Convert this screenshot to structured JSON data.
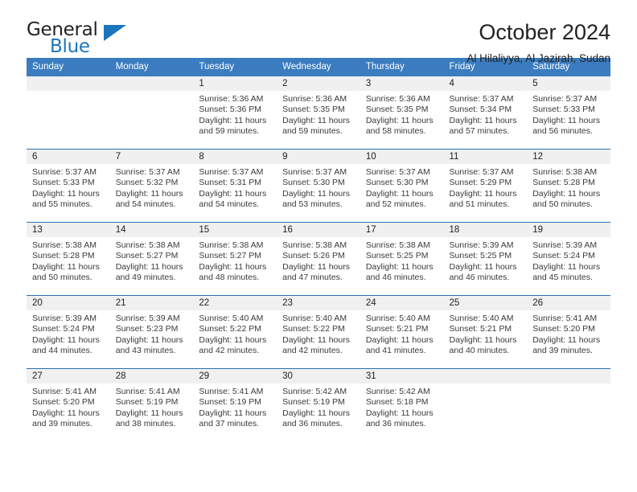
{
  "brand": {
    "name_top": "General",
    "name_bottom": "Blue",
    "accent_color": "#1b75bb"
  },
  "header": {
    "title": "October 2024",
    "subtitle": "Al Hilaliyya, Al Jazirah, Sudan"
  },
  "colors": {
    "header_row_bg": "#3a7cbf",
    "header_row_text": "#ffffff",
    "day_band_bg": "#f0f0f0",
    "week_divider": "#2f6fb2"
  },
  "weekday_headers": [
    "Sunday",
    "Monday",
    "Tuesday",
    "Wednesday",
    "Thursday",
    "Friday",
    "Saturday"
  ],
  "weeks": [
    [
      {
        "day": "",
        "sunrise": "",
        "sunset": "",
        "daylight_1": "",
        "daylight_2": ""
      },
      {
        "day": "",
        "sunrise": "",
        "sunset": "",
        "daylight_1": "",
        "daylight_2": ""
      },
      {
        "day": "1",
        "sunrise": "Sunrise: 5:36 AM",
        "sunset": "Sunset: 5:36 PM",
        "daylight_1": "Daylight: 11 hours",
        "daylight_2": "and 59 minutes."
      },
      {
        "day": "2",
        "sunrise": "Sunrise: 5:36 AM",
        "sunset": "Sunset: 5:35 PM",
        "daylight_1": "Daylight: 11 hours",
        "daylight_2": "and 59 minutes."
      },
      {
        "day": "3",
        "sunrise": "Sunrise: 5:36 AM",
        "sunset": "Sunset: 5:35 PM",
        "daylight_1": "Daylight: 11 hours",
        "daylight_2": "and 58 minutes."
      },
      {
        "day": "4",
        "sunrise": "Sunrise: 5:37 AM",
        "sunset": "Sunset: 5:34 PM",
        "daylight_1": "Daylight: 11 hours",
        "daylight_2": "and 57 minutes."
      },
      {
        "day": "5",
        "sunrise": "Sunrise: 5:37 AM",
        "sunset": "Sunset: 5:33 PM",
        "daylight_1": "Daylight: 11 hours",
        "daylight_2": "and 56 minutes."
      }
    ],
    [
      {
        "day": "6",
        "sunrise": "Sunrise: 5:37 AM",
        "sunset": "Sunset: 5:33 PM",
        "daylight_1": "Daylight: 11 hours",
        "daylight_2": "and 55 minutes."
      },
      {
        "day": "7",
        "sunrise": "Sunrise: 5:37 AM",
        "sunset": "Sunset: 5:32 PM",
        "daylight_1": "Daylight: 11 hours",
        "daylight_2": "and 54 minutes."
      },
      {
        "day": "8",
        "sunrise": "Sunrise: 5:37 AM",
        "sunset": "Sunset: 5:31 PM",
        "daylight_1": "Daylight: 11 hours",
        "daylight_2": "and 54 minutes."
      },
      {
        "day": "9",
        "sunrise": "Sunrise: 5:37 AM",
        "sunset": "Sunset: 5:30 PM",
        "daylight_1": "Daylight: 11 hours",
        "daylight_2": "and 53 minutes."
      },
      {
        "day": "10",
        "sunrise": "Sunrise: 5:37 AM",
        "sunset": "Sunset: 5:30 PM",
        "daylight_1": "Daylight: 11 hours",
        "daylight_2": "and 52 minutes."
      },
      {
        "day": "11",
        "sunrise": "Sunrise: 5:37 AM",
        "sunset": "Sunset: 5:29 PM",
        "daylight_1": "Daylight: 11 hours",
        "daylight_2": "and 51 minutes."
      },
      {
        "day": "12",
        "sunrise": "Sunrise: 5:38 AM",
        "sunset": "Sunset: 5:28 PM",
        "daylight_1": "Daylight: 11 hours",
        "daylight_2": "and 50 minutes."
      }
    ],
    [
      {
        "day": "13",
        "sunrise": "Sunrise: 5:38 AM",
        "sunset": "Sunset: 5:28 PM",
        "daylight_1": "Daylight: 11 hours",
        "daylight_2": "and 50 minutes."
      },
      {
        "day": "14",
        "sunrise": "Sunrise: 5:38 AM",
        "sunset": "Sunset: 5:27 PM",
        "daylight_1": "Daylight: 11 hours",
        "daylight_2": "and 49 minutes."
      },
      {
        "day": "15",
        "sunrise": "Sunrise: 5:38 AM",
        "sunset": "Sunset: 5:27 PM",
        "daylight_1": "Daylight: 11 hours",
        "daylight_2": "and 48 minutes."
      },
      {
        "day": "16",
        "sunrise": "Sunrise: 5:38 AM",
        "sunset": "Sunset: 5:26 PM",
        "daylight_1": "Daylight: 11 hours",
        "daylight_2": "and 47 minutes."
      },
      {
        "day": "17",
        "sunrise": "Sunrise: 5:38 AM",
        "sunset": "Sunset: 5:25 PM",
        "daylight_1": "Daylight: 11 hours",
        "daylight_2": "and 46 minutes."
      },
      {
        "day": "18",
        "sunrise": "Sunrise: 5:39 AM",
        "sunset": "Sunset: 5:25 PM",
        "daylight_1": "Daylight: 11 hours",
        "daylight_2": "and 46 minutes."
      },
      {
        "day": "19",
        "sunrise": "Sunrise: 5:39 AM",
        "sunset": "Sunset: 5:24 PM",
        "daylight_1": "Daylight: 11 hours",
        "daylight_2": "and 45 minutes."
      }
    ],
    [
      {
        "day": "20",
        "sunrise": "Sunrise: 5:39 AM",
        "sunset": "Sunset: 5:24 PM",
        "daylight_1": "Daylight: 11 hours",
        "daylight_2": "and 44 minutes."
      },
      {
        "day": "21",
        "sunrise": "Sunrise: 5:39 AM",
        "sunset": "Sunset: 5:23 PM",
        "daylight_1": "Daylight: 11 hours",
        "daylight_2": "and 43 minutes."
      },
      {
        "day": "22",
        "sunrise": "Sunrise: 5:40 AM",
        "sunset": "Sunset: 5:22 PM",
        "daylight_1": "Daylight: 11 hours",
        "daylight_2": "and 42 minutes."
      },
      {
        "day": "23",
        "sunrise": "Sunrise: 5:40 AM",
        "sunset": "Sunset: 5:22 PM",
        "daylight_1": "Daylight: 11 hours",
        "daylight_2": "and 42 minutes."
      },
      {
        "day": "24",
        "sunrise": "Sunrise: 5:40 AM",
        "sunset": "Sunset: 5:21 PM",
        "daylight_1": "Daylight: 11 hours",
        "daylight_2": "and 41 minutes."
      },
      {
        "day": "25",
        "sunrise": "Sunrise: 5:40 AM",
        "sunset": "Sunset: 5:21 PM",
        "daylight_1": "Daylight: 11 hours",
        "daylight_2": "and 40 minutes."
      },
      {
        "day": "26",
        "sunrise": "Sunrise: 5:41 AM",
        "sunset": "Sunset: 5:20 PM",
        "daylight_1": "Daylight: 11 hours",
        "daylight_2": "and 39 minutes."
      }
    ],
    [
      {
        "day": "27",
        "sunrise": "Sunrise: 5:41 AM",
        "sunset": "Sunset: 5:20 PM",
        "daylight_1": "Daylight: 11 hours",
        "daylight_2": "and 39 minutes."
      },
      {
        "day": "28",
        "sunrise": "Sunrise: 5:41 AM",
        "sunset": "Sunset: 5:19 PM",
        "daylight_1": "Daylight: 11 hours",
        "daylight_2": "and 38 minutes."
      },
      {
        "day": "29",
        "sunrise": "Sunrise: 5:41 AM",
        "sunset": "Sunset: 5:19 PM",
        "daylight_1": "Daylight: 11 hours",
        "daylight_2": "and 37 minutes."
      },
      {
        "day": "30",
        "sunrise": "Sunrise: 5:42 AM",
        "sunset": "Sunset: 5:19 PM",
        "daylight_1": "Daylight: 11 hours",
        "daylight_2": "and 36 minutes."
      },
      {
        "day": "31",
        "sunrise": "Sunrise: 5:42 AM",
        "sunset": "Sunset: 5:18 PM",
        "daylight_1": "Daylight: 11 hours",
        "daylight_2": "and 36 minutes."
      },
      {
        "day": "",
        "sunrise": "",
        "sunset": "",
        "daylight_1": "",
        "daylight_2": ""
      },
      {
        "day": "",
        "sunrise": "",
        "sunset": "",
        "daylight_1": "",
        "daylight_2": ""
      }
    ]
  ]
}
